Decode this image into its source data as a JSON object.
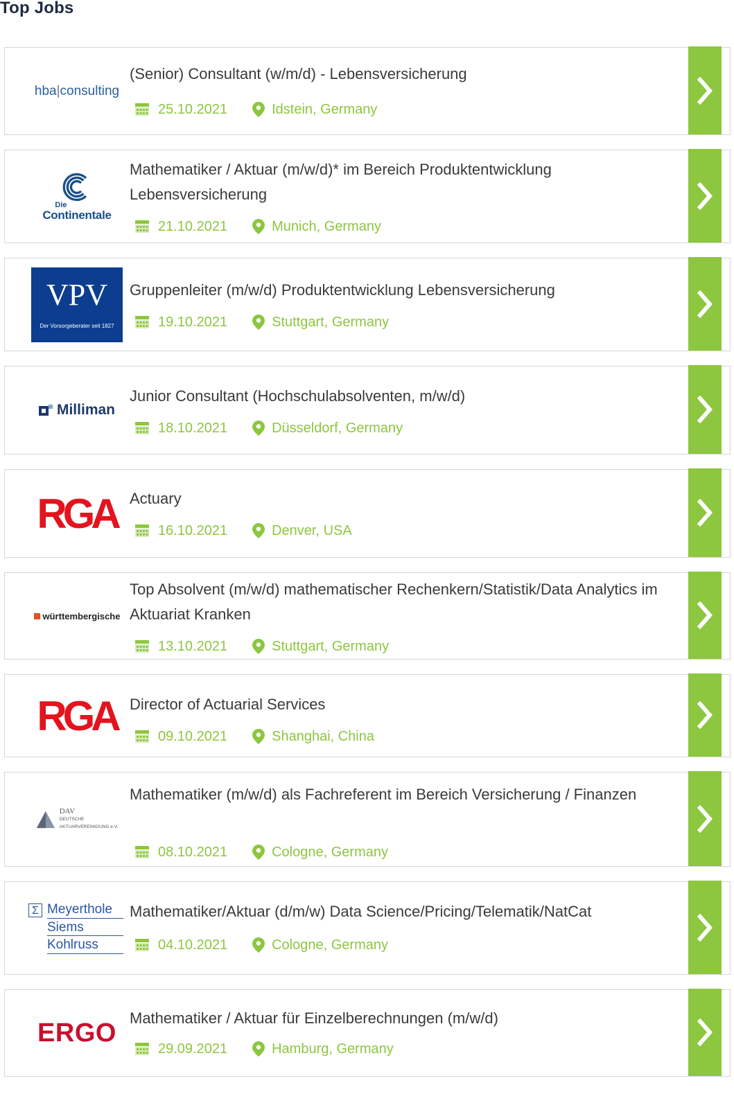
{
  "page": {
    "title": "Top Jobs"
  },
  "colors": {
    "accent": "#8dc63f",
    "card_border": "#d6d6d6",
    "title_text": "#3a3a3a"
  },
  "icons": {
    "date": "calendar-icon",
    "location": "map-pin-icon",
    "open": "chevron-right-icon"
  },
  "jobs": [
    {
      "logo": {
        "kind": "hba",
        "line1": "hba",
        "line2": "consulting"
      },
      "title": "(Senior) Consultant (w/m/d) - Lebensversicherung",
      "date": "25.10.2021",
      "location": "Idstein, Germany"
    },
    {
      "logo": {
        "kind": "continentale",
        "line1": "Die",
        "line2": "Continentale"
      },
      "title": "Mathematiker / Aktuar (m/w/d)* im Bereich Produktentwicklung Lebensversicherung",
      "date": "21.10.2021",
      "location": "Munich, Germany"
    },
    {
      "logo": {
        "kind": "vpv",
        "line1": "VPV",
        "line2": "Der Vorsorgeberater seit 1827"
      },
      "title": "Gruppenleiter (m/w/d) Produktentwicklung Lebensversicherung",
      "date": "19.10.2021",
      "location": "Stuttgart, Germany"
    },
    {
      "logo": {
        "kind": "milliman",
        "line1": "Milliman"
      },
      "title": "Junior Consultant (Hochschulabsolventen, m/w/d)",
      "date": "18.10.2021",
      "location": "Düsseldorf, Germany"
    },
    {
      "logo": {
        "kind": "rga",
        "line1": "RGA"
      },
      "title": "Actuary",
      "date": "16.10.2021",
      "location": "Denver, USA"
    },
    {
      "logo": {
        "kind": "wuerttembergische",
        "line1": "württembergische"
      },
      "title": "Top Absolvent (m/w/d) mathematischer Rechenkern/Statistik/Data Analytics im Aktuariat Kranken",
      "date": "13.10.2021",
      "location": "Stuttgart, Germany"
    },
    {
      "logo": {
        "kind": "rga",
        "line1": "RGA"
      },
      "title": "Director of Actuarial Services",
      "date": "09.10.2021",
      "location": "Shanghai, China"
    },
    {
      "logo": {
        "kind": "dav",
        "line1": "DAV",
        "line2": "DEUTSCHE",
        "line3": "AKTUARVEREINIGUNG e.V."
      },
      "title": "Mathematiker (m/w/d) als Fachreferent im Bereich Versicherung / Finanzen",
      "date": "08.10.2021",
      "location": "Cologne, Germany"
    },
    {
      "logo": {
        "kind": "msk",
        "line1": "Meyerthole",
        "line2": "Siems",
        "line3": "Kohlruss"
      },
      "title": "Mathematiker/Aktuar (d/m/w) Data Science/Pricing/Telematik/NatCat",
      "date": "04.10.2021",
      "location": "Cologne, Germany"
    },
    {
      "logo": {
        "kind": "ergo",
        "line1": "ERGO"
      },
      "title": "Mathematiker / Aktuar für Einzelberechnungen (m/w/d)",
      "date": "29.09.2021",
      "location": "Hamburg, Germany"
    }
  ]
}
